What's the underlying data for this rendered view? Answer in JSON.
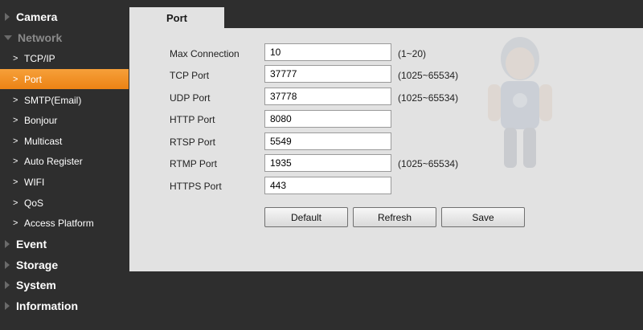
{
  "sidebar": {
    "sections": [
      {
        "label": "Camera",
        "open": false
      },
      {
        "label": "Network",
        "open": true
      },
      {
        "label": "Event",
        "open": false
      },
      {
        "label": "Storage",
        "open": false
      },
      {
        "label": "System",
        "open": false
      },
      {
        "label": "Information",
        "open": false
      }
    ],
    "network_items": [
      {
        "label": "TCP/IP"
      },
      {
        "label": "Port",
        "active": true
      },
      {
        "label": "SMTP(Email)"
      },
      {
        "label": "Bonjour"
      },
      {
        "label": "Multicast"
      },
      {
        "label": "Auto Register"
      },
      {
        "label": "WIFI"
      },
      {
        "label": "QoS"
      },
      {
        "label": "Access Platform"
      }
    ]
  },
  "tab": {
    "label": "Port"
  },
  "form": {
    "rows": [
      {
        "label": "Max Connection",
        "value": "10",
        "hint": "(1~20)"
      },
      {
        "label": "TCP Port",
        "value": "37777",
        "hint": "(1025~65534)"
      },
      {
        "label": "UDP Port",
        "value": "37778",
        "hint": "(1025~65534)"
      },
      {
        "label": "HTTP Port",
        "value": "8080",
        "hint": ""
      },
      {
        "label": "RTSP Port",
        "value": "5549",
        "hint": ""
      },
      {
        "label": "RTMP Port",
        "value": "1935",
        "hint": "(1025~65534)"
      },
      {
        "label": "HTTPS Port",
        "value": "443",
        "hint": ""
      }
    ]
  },
  "buttons": {
    "default_label": "Default",
    "refresh_label": "Refresh",
    "save_label": "Save"
  },
  "colors": {
    "sidebar_bg": "#2e2e2e",
    "active_item": "#f08a1c",
    "panel_bg": "#e2e2e2"
  }
}
